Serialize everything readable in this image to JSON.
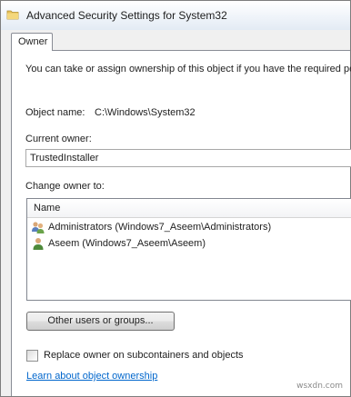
{
  "window": {
    "title": "Advanced Security Settings for System32",
    "icon": "folder-icon"
  },
  "tabs": [
    {
      "label": "Owner",
      "selected": true
    }
  ],
  "owner_tab": {
    "intro": "You can take or assign ownership of this object if you have the required per",
    "object_name_label": "Object name:",
    "object_name_value": "C:\\Windows\\System32",
    "current_owner_label": "Current owner:",
    "current_owner_value": "TrustedInstaller",
    "change_owner_label": "Change owner to:",
    "list_header": "Name",
    "owner_candidates": [
      {
        "label": "Administrators (Windows7_Aseem\\Administrators)",
        "icon": "user-group-icon"
      },
      {
        "label": "Aseem (Windows7_Aseem\\Aseem)",
        "icon": "user-icon"
      }
    ],
    "other_users_button": "Other users or groups...",
    "replace_owner_label": "Replace owner on subcontainers and objects",
    "replace_owner_checked": false,
    "learn_link": "Learn about object ownership"
  },
  "watermark": "wsxdn.com",
  "colors": {
    "link": "#0066cc",
    "frame_bg": "#f0f0f0",
    "panel_bg": "#ffffff"
  }
}
